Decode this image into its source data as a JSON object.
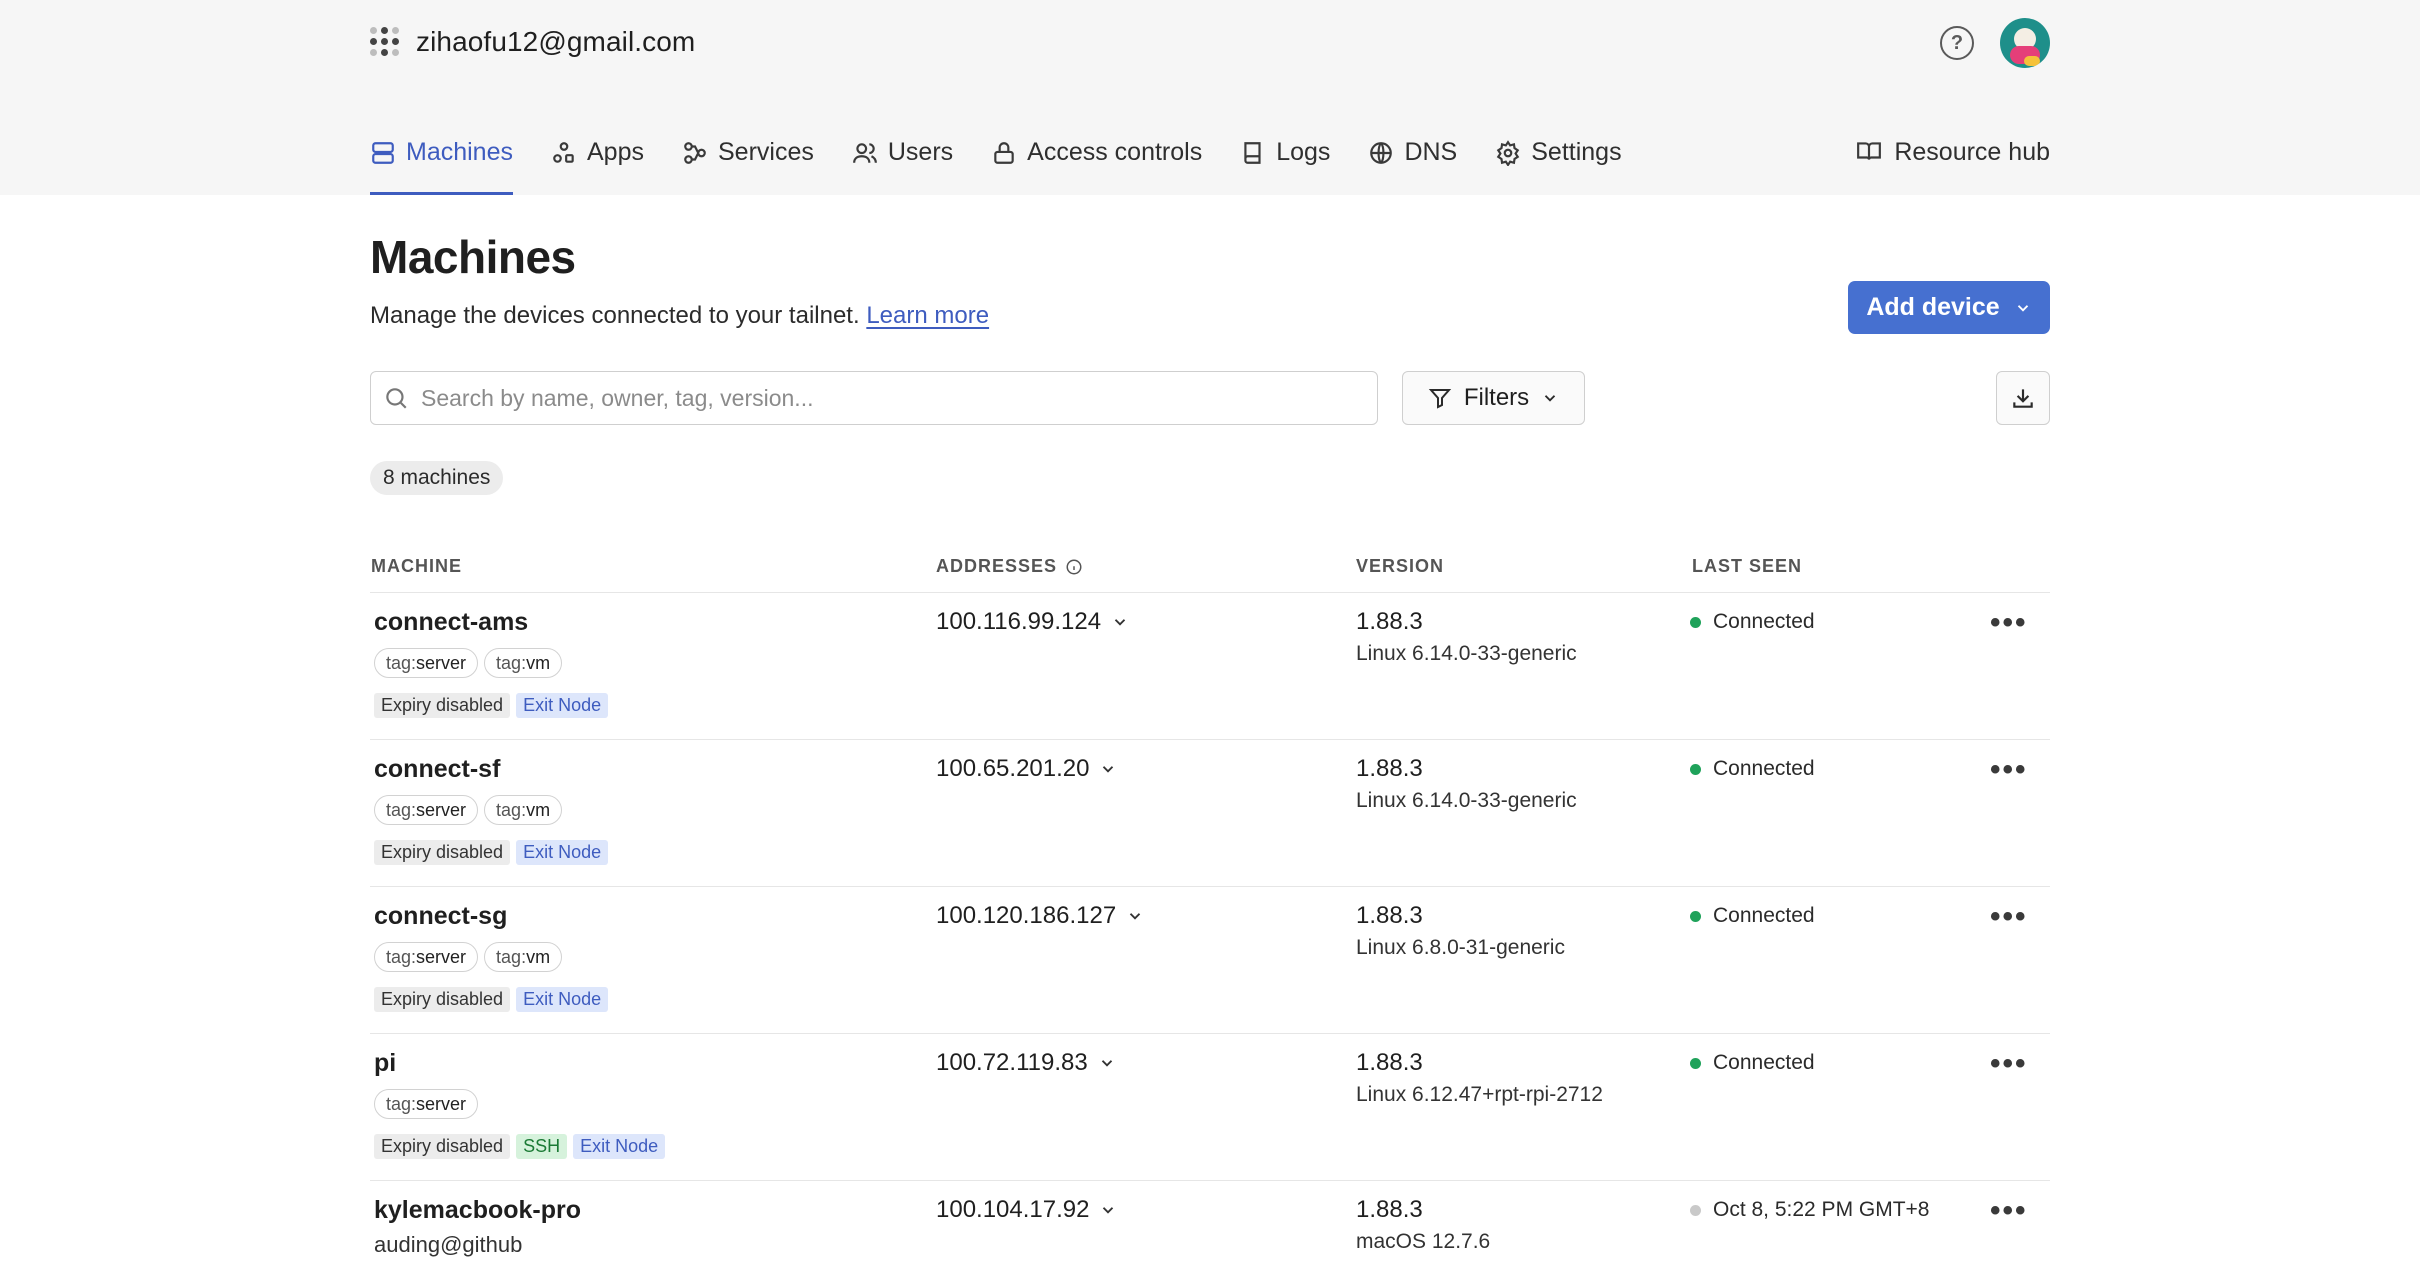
{
  "header": {
    "account": "zihaofu12@gmail.com",
    "help_label": "?"
  },
  "nav": {
    "items": [
      {
        "label": "Machines",
        "icon": "server-icon",
        "active": true
      },
      {
        "label": "Apps",
        "icon": "apps-icon"
      },
      {
        "label": "Services",
        "icon": "services-icon"
      },
      {
        "label": "Users",
        "icon": "users-icon"
      },
      {
        "label": "Access controls",
        "icon": "lock-icon"
      },
      {
        "label": "Logs",
        "icon": "book-icon"
      },
      {
        "label": "DNS",
        "icon": "globe-icon"
      },
      {
        "label": "Settings",
        "icon": "gear-icon"
      }
    ],
    "resource_hub": "Resource hub"
  },
  "page": {
    "title": "Machines",
    "subtitle": "Manage the devices connected to your tailnet.",
    "learn_more": "Learn more",
    "add_device": "Add device",
    "search_placeholder": "Search by name, owner, tag, version...",
    "filters": "Filters",
    "count": "8 machines"
  },
  "table": {
    "headers": {
      "machine": "MACHINE",
      "addresses": "ADDRESSES",
      "version": "VERSION",
      "last_seen": "LAST SEEN"
    },
    "rows": [
      {
        "name": "connect-ams",
        "tags": [
          {
            "k": "tag:",
            "v": "server"
          },
          {
            "k": "tag:",
            "v": "vm"
          }
        ],
        "badges": [
          {
            "label": "Expiry disabled",
            "style": "gray"
          },
          {
            "label": "Exit Node",
            "style": "blue"
          }
        ],
        "address": "100.116.99.124",
        "version": "1.88.3",
        "os": "Linux 6.14.0-33-generic",
        "last_seen": "Connected",
        "online": true
      },
      {
        "name": "connect-sf",
        "tags": [
          {
            "k": "tag:",
            "v": "server"
          },
          {
            "k": "tag:",
            "v": "vm"
          }
        ],
        "badges": [
          {
            "label": "Expiry disabled",
            "style": "gray"
          },
          {
            "label": "Exit Node",
            "style": "blue"
          }
        ],
        "address": "100.65.201.20",
        "version": "1.88.3",
        "os": "Linux 6.14.0-33-generic",
        "last_seen": "Connected",
        "online": true
      },
      {
        "name": "connect-sg",
        "tags": [
          {
            "k": "tag:",
            "v": "server"
          },
          {
            "k": "tag:",
            "v": "vm"
          }
        ],
        "badges": [
          {
            "label": "Expiry disabled",
            "style": "gray"
          },
          {
            "label": "Exit Node",
            "style": "blue"
          }
        ],
        "address": "100.120.186.127",
        "version": "1.88.3",
        "os": "Linux 6.8.0-31-generic",
        "last_seen": "Connected",
        "online": true
      },
      {
        "name": "pi",
        "tags": [
          {
            "k": "tag:",
            "v": "server"
          }
        ],
        "badges": [
          {
            "label": "Expiry disabled",
            "style": "gray"
          },
          {
            "label": "SSH",
            "style": "green"
          },
          {
            "label": "Exit Node",
            "style": "blue"
          }
        ],
        "address": "100.72.119.83",
        "version": "1.88.3",
        "os": "Linux 6.12.47+rpt-rpi-2712",
        "last_seen": "Connected",
        "online": true
      },
      {
        "name": "kylemacbook-pro",
        "owner": "auding@github",
        "tags": [],
        "badges": [],
        "address": "100.104.17.92",
        "version": "1.88.3",
        "os": "macOS 12.7.6",
        "last_seen": "Oct 8, 5:22 PM GMT+8",
        "online": false
      }
    ],
    "more_label": "•••"
  },
  "colors": {
    "accent": "#3e5cbf",
    "button": "#4670d0",
    "online": "#1fa25a"
  }
}
